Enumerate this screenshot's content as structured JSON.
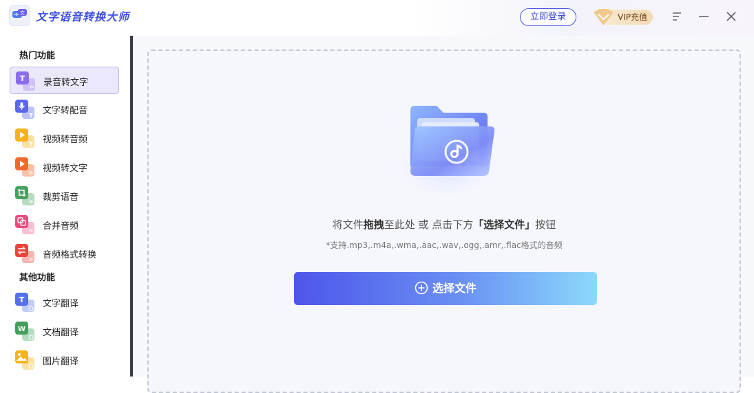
{
  "app": {
    "title": "文字语音转换大师"
  },
  "header": {
    "login_label": "立即登录",
    "vip_label": "VIP充值"
  },
  "sidebar": {
    "hot_title": "热门功能",
    "other_title": "其他功能",
    "hot_items": [
      {
        "label": "录音转文字",
        "icon": "record-to-text-icon",
        "color": "#8b6cf0",
        "glyph": "T"
      },
      {
        "label": "文字转配音",
        "icon": "text-to-voice-icon",
        "color": "#5966ee",
        "glyph": "mic"
      },
      {
        "label": "视频转音频",
        "icon": "video-to-audio-icon",
        "color": "#f5b21c",
        "glyph": "play"
      },
      {
        "label": "视频转文字",
        "icon": "video-to-text-icon",
        "color": "#f06a2c",
        "glyph": "play"
      },
      {
        "label": "裁剪语音",
        "icon": "crop-audio-icon",
        "color": "#4aa05e",
        "glyph": "crop"
      },
      {
        "label": "合并音频",
        "icon": "merge-audio-icon",
        "color": "#ef4a7c",
        "glyph": "merge"
      },
      {
        "label": "音频格式转换",
        "icon": "audio-format-convert-icon",
        "color": "#e8443a",
        "glyph": "swap"
      }
    ],
    "other_items": [
      {
        "label": "文字翻译",
        "icon": "text-translate-icon",
        "color": "#5470ec",
        "glyph": "T"
      },
      {
        "label": "文档翻译",
        "icon": "doc-translate-icon",
        "color": "#43a05a",
        "glyph": "W"
      },
      {
        "label": "图片翻译",
        "icon": "image-translate-icon",
        "color": "#f3b51d",
        "glyph": "img"
      }
    ]
  },
  "main": {
    "drop_text_1": "将文件",
    "drop_text_bold_1": "拖拽",
    "drop_text_2": "至此处 或 点击下方",
    "drop_text_bold_2": "「选择文件」",
    "drop_text_3": "按钮",
    "support_text": "*支持.mp3,.m4a,.wma,.aac,.wav,.ogg,.amr,.flac格式的音频",
    "select_button_label": "选择文件"
  },
  "colors": {
    "accent": "#4a56e6",
    "vip_gold": "#f3dbb3"
  }
}
